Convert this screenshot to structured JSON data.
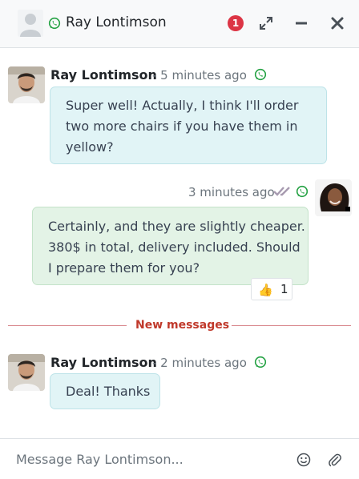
{
  "header": {
    "contact_name": "Ray Lontimson",
    "unread_count": "1",
    "icons": [
      "avatar-placeholder",
      "whatsapp-icon",
      "expand-icon",
      "minimize-icon",
      "close-icon"
    ]
  },
  "messages": [
    {
      "direction": "incoming",
      "author": "Ray Lontimson",
      "time": "- 5 minutes ago",
      "channel": "whatsapp",
      "lines": [
        "Super well! Actually, I think I'll order",
        "two more chairs if you have them in",
        "yellow?"
      ]
    },
    {
      "direction": "outgoing",
      "time": "3 minutes ago",
      "status": "read",
      "channel": "whatsapp",
      "lines": [
        "Certainly, and they are slightly cheaper.",
        "380$ in total, delivery included. Should",
        "I prepare them for you?"
      ],
      "reaction": {
        "emoji": "👍",
        "count": "1"
      }
    },
    {
      "direction": "incoming",
      "author": "Ray Lontimson",
      "time": "- 2 minutes ago",
      "channel": "whatsapp",
      "lines": [
        "Deal! Thanks"
      ]
    }
  ],
  "separator": {
    "label": "New messages"
  },
  "composer": {
    "placeholder": "Message Ray Lontimson...",
    "icons": [
      "emoji-icon",
      "attachment-icon"
    ]
  },
  "colors": {
    "whatsapp": "#25a244",
    "badge": "#dc3545",
    "incoming_bubble": "#e1f4f6",
    "outgoing_bubble": "#e3f3e6",
    "separator": "#c0392b"
  }
}
